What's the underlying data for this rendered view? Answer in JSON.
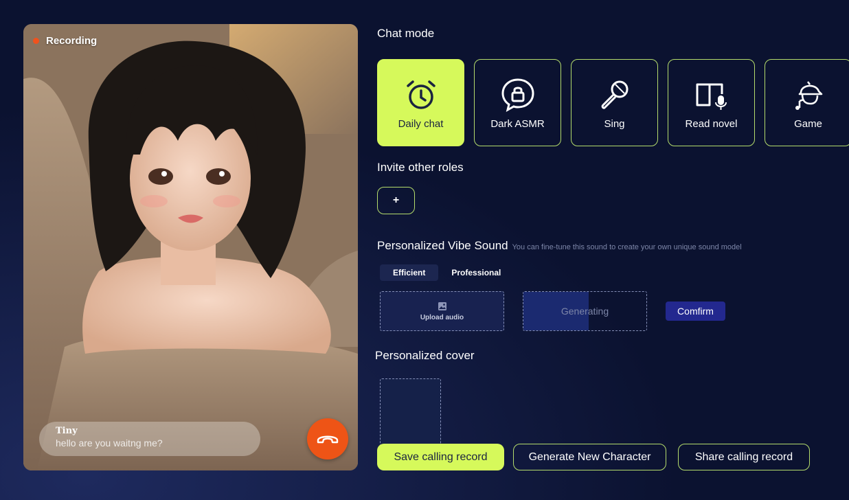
{
  "video": {
    "recording_label": "Recording",
    "bubble_name": "Tiny",
    "bubble_text": "hello  are you waitng me?"
  },
  "chat_mode": {
    "title": "Chat mode",
    "modes": [
      {
        "label": "Daily chat",
        "icon": "alarm-clock-icon",
        "active": true
      },
      {
        "label": "Dark ASMR",
        "icon": "lock-bubble-icon",
        "active": false
      },
      {
        "label": "Sing",
        "icon": "microphone-icon",
        "active": false
      },
      {
        "label": "Read novel",
        "icon": "book-mic-icon",
        "active": false
      },
      {
        "label": "Game",
        "icon": "game-character-icon",
        "active": false
      }
    ]
  },
  "invite": {
    "title": "Invite other roles",
    "add_label": "+"
  },
  "vibe": {
    "title": "Personalized Vibe Sound",
    "subtitle": "You can fine-tune this sound to create your own unique sound model",
    "tabs": [
      "Efficient",
      "Professional"
    ],
    "active_tab": "Efficient",
    "upload_label": "Upload audio",
    "generating_label": "Generating",
    "generating_progress": 0.53,
    "confirm_label": "Comfirm"
  },
  "cover": {
    "title": "Personalized cover"
  },
  "actions": {
    "save": "Save calling record",
    "generate": "Generate New Character",
    "share": "Share calling record"
  },
  "colors": {
    "accent": "#d6f95b",
    "outline": "#b5dd6c",
    "background": "#0b1230",
    "hangup": "#ee5416",
    "confirm": "#23288f"
  }
}
